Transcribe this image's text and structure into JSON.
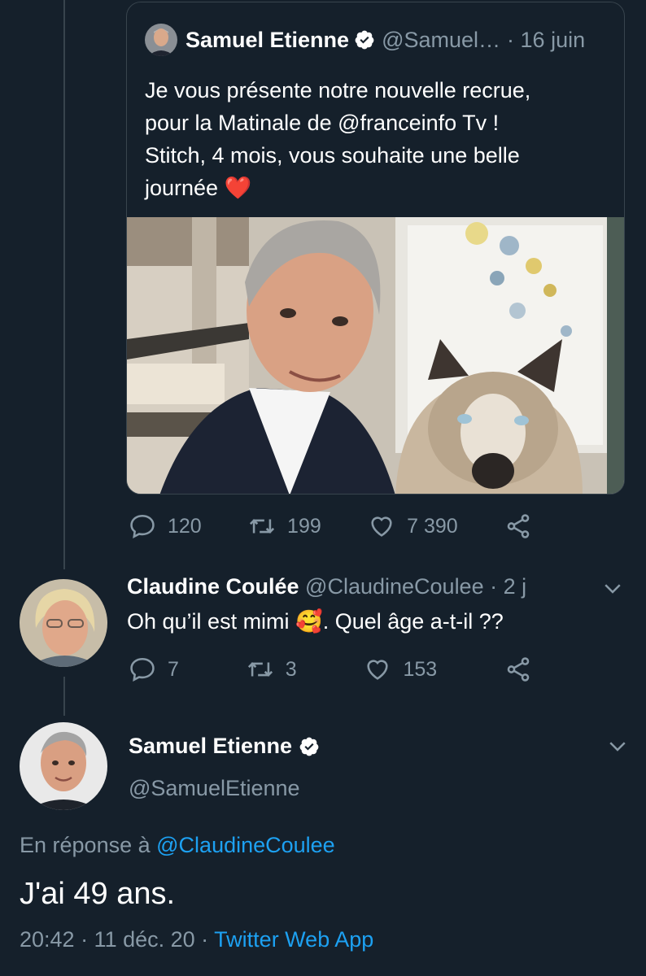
{
  "quoted_tweet": {
    "author_name": "Samuel Etienne",
    "handle": "@Samuel…",
    "date": "· 16 juin",
    "text_lines": [
      "Je vous présente notre nouvelle recrue,",
      "pour la Matinale de @franceinfo Tv !",
      "Stitch, 4 mois, vous souhaite une belle",
      "journée"
    ],
    "emoji": "❤️",
    "photo_icon": "photo-man-with-dog",
    "stats": {
      "replies": "120",
      "retweets": "199",
      "likes": "7 390"
    }
  },
  "reply": {
    "author_name": "Claudine Coulée",
    "handle": "@ClaudineCoulee",
    "date": "· 2 j",
    "text_before": "Oh qu’il est mimi",
    "emoji": "🥰",
    "text_after": ". Quel âge a-t-il ??",
    "stats": {
      "replies": "7",
      "retweets": "3",
      "likes": "153"
    }
  },
  "main_tweet": {
    "author_name": "Samuel Etienne",
    "handle": "@SamuelEtienne",
    "reply_prefix": "En réponse à",
    "reply_to": "@ClaudineCoulee",
    "text": "J'ai 49 ans.",
    "time_date": "20:42 · 11 déc. 20 ·",
    "source": "Twitter Web App"
  },
  "colors": {
    "background": "#15202b",
    "muted": "#8899a6",
    "link": "#1da1f2",
    "border": "#38444d",
    "verified": "#ffffff"
  }
}
